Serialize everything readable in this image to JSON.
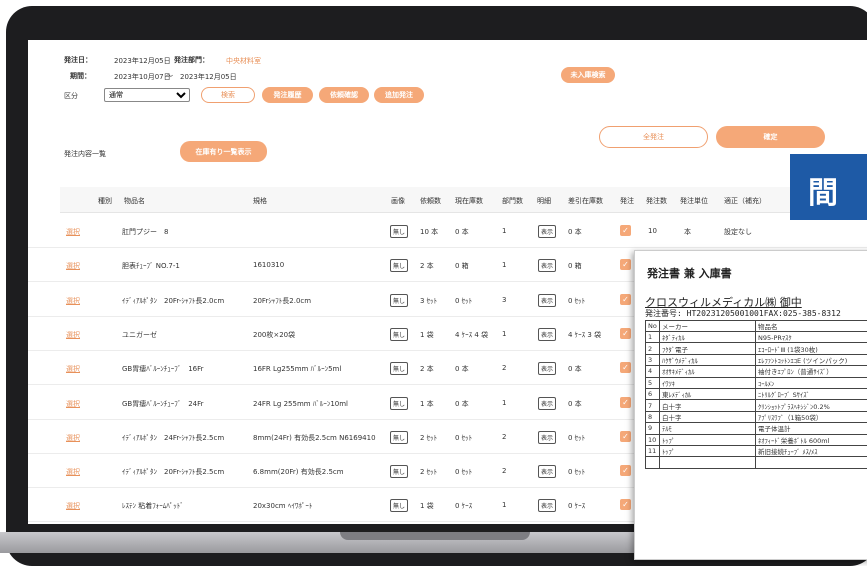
{
  "form": {
    "order_date_label": "発注日：",
    "order_date": "2023年12月05日",
    "dept_label": "発注部門：",
    "dept_value": "中央材料室",
    "period_label": "期間：",
    "period_from": "2023年10月07日",
    "period_sep": "〜",
    "period_to": "2023年12月05日",
    "category_label": "区分",
    "category_selected": "通常",
    "search_button": "検索",
    "history_button": "発注履歴",
    "request_button": "依頼確認",
    "additional_button": "追加発注",
    "unreceived_button": "未入庫検索",
    "all_order_button": "全発注",
    "confirm_button": "確定",
    "list_label": "発注内容一覧",
    "in_stock_button": "在庫有り一覧表示"
  },
  "table": {
    "headers": [
      "種別",
      "物品名",
      "規格",
      "画像",
      "依頼数",
      "現在庫数",
      "部門数",
      "明細",
      "差引在庫数",
      "発注",
      "発注数",
      "発注単位",
      "適正（補充）"
    ],
    "select_text": "選択",
    "image_tag": "無し",
    "detail_tag": "表示",
    "check_mark": "✓",
    "rows": [
      {
        "name": "肛門プジー　8",
        "spec": "",
        "req": "10 本",
        "stock": "0 本",
        "dept": "1",
        "diff": "0 本",
        "qty": "10",
        "unit": "本",
        "proper": "設定なし"
      },
      {
        "name": "胆表ﾁｭｰﾌﾞ NO.7-1",
        "spec": "1610310",
        "req": "2 本",
        "stock": "0 箱",
        "dept": "1",
        "diff": "0 箱",
        "qty": "",
        "unit": "",
        "proper": ""
      },
      {
        "name": "ｲﾃﾞｨｱﾙﾎﾟﾀﾝ　20Fr-ｼｬﾌﾄ長2.0cm",
        "spec": "20Frｼｬﾌﾄ長2.0cm",
        "req": "3 ｾｯﾄ",
        "stock": "0 ｾｯﾄ",
        "dept": "3",
        "diff": "0 ｾｯﾄ",
        "qty": "",
        "unit": "",
        "proper": ""
      },
      {
        "name": "ユニガーゼ",
        "spec": "200枚×20袋",
        "req": "1 袋",
        "stock": "4 ｹｰｽ 4 袋",
        "dept": "1",
        "diff": "4 ｹｰｽ 3 袋",
        "qty": "",
        "unit": "",
        "proper": ""
      },
      {
        "name": "GB胃瘻ﾊﾞﾙｰﾝﾁｭｰﾌﾞ　16Fr",
        "spec": "16FR Lg255mm ﾊﾞﾙｰﾝ5ml",
        "req": "2 本",
        "stock": "0 本",
        "dept": "2",
        "diff": "0 本",
        "qty": "",
        "unit": "",
        "proper": ""
      },
      {
        "name": "GB胃瘻ﾊﾞﾙｰﾝﾁｭｰﾌﾞ　24Fr",
        "spec": "24FR Lg 255mm ﾊﾞﾙｰﾝ10ml",
        "req": "1 本",
        "stock": "0 本",
        "dept": "1",
        "diff": "0 本",
        "qty": "",
        "unit": "",
        "proper": ""
      },
      {
        "name": "ｲﾃﾞｨｱﾙﾎﾟﾀﾝ　24Fr-ｼｬﾌﾄ長2.5cm",
        "spec": "8mm(24Fr) 有効長2.5cm N6169410",
        "req": "2 ｾｯﾄ",
        "stock": "0 ｾｯﾄ",
        "dept": "2",
        "diff": "0 ｾｯﾄ",
        "qty": "",
        "unit": "",
        "proper": ""
      },
      {
        "name": "ｲﾃﾞｨｱﾙﾎﾟﾀﾝ　20Fr-ｼｬﾌﾄ長2.5cm",
        "spec": "6.8mm(20Fr) 有効長2.5cm",
        "req": "2 ｾｯﾄ",
        "stock": "0 ｾｯﾄ",
        "dept": "2",
        "diff": "0 ｾｯﾄ",
        "qty": "",
        "unit": "",
        "proper": ""
      },
      {
        "name": "ﾚｽﾃﾝ 粘着ﾌｫｰﾑﾊﾟｯﾄﾞ",
        "spec": "20x30cm ﾍｲﾜﾎﾟｰﾄ",
        "req": "1 袋",
        "stock": "0 ｹｰｽ",
        "dept": "1",
        "diff": "0 ｹｰｽ",
        "qty": "",
        "unit": "",
        "proper": ""
      }
    ]
  },
  "banner_text": "間",
  "document": {
    "title": "発注書 兼 入庫書",
    "recipient": "クロスウィルメディカル㈱ 御中",
    "order_no": "発注番号: HT20231205001001FAX:025-385-8312",
    "headers": [
      "No",
      "メーカー",
      "物品名"
    ],
    "rows": [
      [
        "1",
        "ﾈﾀﾞﾃｨｶﾙ",
        "N95-PRﾏｽｸ"
      ],
      [
        "2",
        "ﾌｸﾀﾞ電子",
        "ｴｺｰﾛｰﾄﾞⅢ (1袋30枚)"
      ],
      [
        "3",
        "ﾊｸｻﾞｳﾒﾃﾞｨｶﾙ",
        "ｴﾚﾌｧﾝﾄｺｯﾄﾝｴｺE (ツインパック)"
      ],
      [
        "4",
        "ｵｵｻｷﾒﾃﾞｨｶﾙ",
        "袖付きｴﾌﾟﾛﾝ（普通ｻｲｽﾞ）"
      ],
      [
        "5",
        "ｲﾜﾂｷ",
        "ｺｰﾙﾒﾝ"
      ],
      [
        "6",
        "東ﾚﾒﾃﾞｨｶﾙ",
        "ﾆﾄﾘﾙｸﾞﾛｰﾌﾞ Sｻｲｽﾞ"
      ],
      [
        "7",
        "白十字",
        "ｸﾘﾝｼｮｯﾄﾌﾟﾗｽﾍｷｼｼﾞﾝ0.2%"
      ],
      [
        "8",
        "白十字",
        "ｱﾌﾟﾘｽﾜﾌﾞ（1箱50袋）"
      ],
      [
        "9",
        "ﾃﾙﾓ",
        "電子体温計"
      ],
      [
        "10",
        "ﾄｯﾌﾟ",
        "ﾈｵﾌｨｰﾄﾞ栄養ﾎﾞﾄﾙ 600ml"
      ],
      [
        "11",
        "ﾄｯﾌﾟ",
        "新旧接続ﾁｭｰﾌﾞ ﾒｽ/ﾒｽ"
      ],
      [
        "",
        "",
        ""
      ]
    ]
  }
}
